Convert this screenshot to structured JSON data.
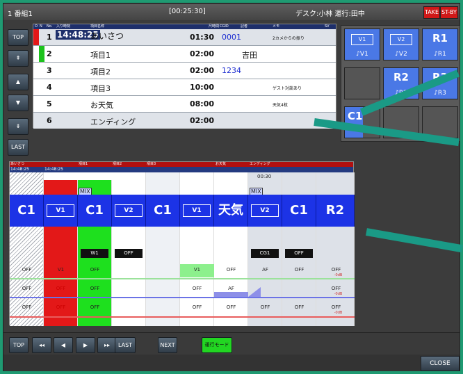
{
  "title": {
    "program": "1 番組1",
    "time": "[00:25:30]",
    "staff": "デスク:小林 運行:田中",
    "take": "TAKE",
    "stby": "ST-BY"
  },
  "side_buttons": [
    "TOP",
    "⇞",
    "▲",
    "▼",
    "⇟",
    "LAST"
  ],
  "list": {
    "headers": [
      "O",
      "N",
      "No.",
      "入り時刻",
      "項目名称",
      "尺時間",
      "CGID",
      "記者",
      "メモ",
      "SV"
    ],
    "rows": [
      {
        "no": "1",
        "start": "14:48:25",
        "name": "あいさつ",
        "dur": "01:30",
        "cgid": "0001",
        "reporter": "",
        "memo": "2カメからの振り"
      },
      {
        "no": "2",
        "start": "",
        "name": "項目1",
        "dur": "02:00",
        "cgid": "",
        "reporter": "吉田",
        "memo": ""
      },
      {
        "no": "3",
        "start": "",
        "name": "項目2",
        "dur": "02:00",
        "cgid": "1234",
        "reporter": "",
        "memo": ""
      },
      {
        "no": "4",
        "start": "",
        "name": "項目3",
        "dur": "10:00",
        "cgid": "",
        "reporter": "",
        "memo": "ゲスト対談あり"
      },
      {
        "no": "5",
        "start": "",
        "name": "お天気",
        "dur": "08:00",
        "cgid": "",
        "reporter": "",
        "memo": "天気4枚"
      },
      {
        "no": "6",
        "start": "",
        "name": "エンディング",
        "dur": "02:00",
        "cgid": "",
        "reporter": "",
        "memo": ""
      }
    ]
  },
  "pads": {
    "v1_top": "V1",
    "v1_bot": "♪V1",
    "v2_top": "V2",
    "v2_bot": "♪V2",
    "r1_top": "R1",
    "r1_bot": "♪R1",
    "r2_top": "R2",
    "r2_bot": "♪R2",
    "r3_top": "R3",
    "r3_bot": "♪R3",
    "c1_top": "C1"
  },
  "timeline": {
    "heads": [
      "あいさつ",
      "項目1",
      "項目2",
      "項目3",
      "お天気",
      "エンディング"
    ],
    "sub_left": "14:48:25",
    "sub_right": "14:48:25",
    "counter": "00:30",
    "mix": "MIX",
    "blocks": [
      "C1",
      "V1",
      "C1",
      "V2",
      "C1",
      "V1",
      "天気",
      "V2",
      "C1",
      "R2"
    ],
    "w1": "W1",
    "off": "OFF",
    "cg1": "CG1",
    "r1": [
      "OFF",
      "V1",
      "OFF",
      "",
      "",
      "V1",
      "OFF",
      "AF",
      "OFF",
      "OFF"
    ],
    "r2": [
      "OFF",
      "OFF",
      "OFF",
      "",
      "",
      "OFF",
      "AF",
      "",
      "",
      "OFF"
    ],
    "r3": [
      "OFF",
      "OFF",
      "OFF",
      "",
      "",
      "OFF",
      "OFF",
      "OFF",
      "OFF",
      "OFF"
    ],
    "db": "-0dB"
  },
  "bottom": {
    "top": "TOP",
    "ff_back": "◂◂",
    "back": "◀",
    "fwd": "▶",
    "ff_fwd": "▸▸",
    "last": "LAST",
    "next": "NEXT",
    "mode": "運行モード"
  },
  "close": "CLOSE"
}
